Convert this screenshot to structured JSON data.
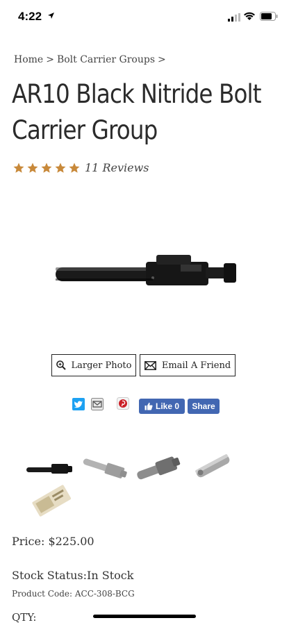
{
  "status_bar": {
    "time": "4:22"
  },
  "breadcrumb": {
    "items": [
      "Home",
      "Bolt Carrier Groups"
    ],
    "separator": ">"
  },
  "product": {
    "title": "AR10 Black Nitride Bolt Carrier Group",
    "rating_stars": 5,
    "reviews_text": "11 Reviews",
    "price_label": "Price: $225.00",
    "stock_label": "Stock Status:In Stock",
    "code_label": "Product Code: ACC-308-BCG",
    "qty_label": "QTY:"
  },
  "actions": {
    "larger_photo": "Larger Photo",
    "email_friend": "Email A Friend"
  },
  "social": {
    "fb_like": "Like 0",
    "fb_share": "Share"
  },
  "icons": [
    "twitter-icon",
    "email-icon",
    "pinterest-icon",
    "facebook-icon",
    "zoom-icon",
    "envelope-icon",
    "star-icon"
  ],
  "colors": {
    "star": "#c8893a",
    "facebook": "#4267b2",
    "twitter": "#1da1f2",
    "pinterest": "#cb2027"
  }
}
